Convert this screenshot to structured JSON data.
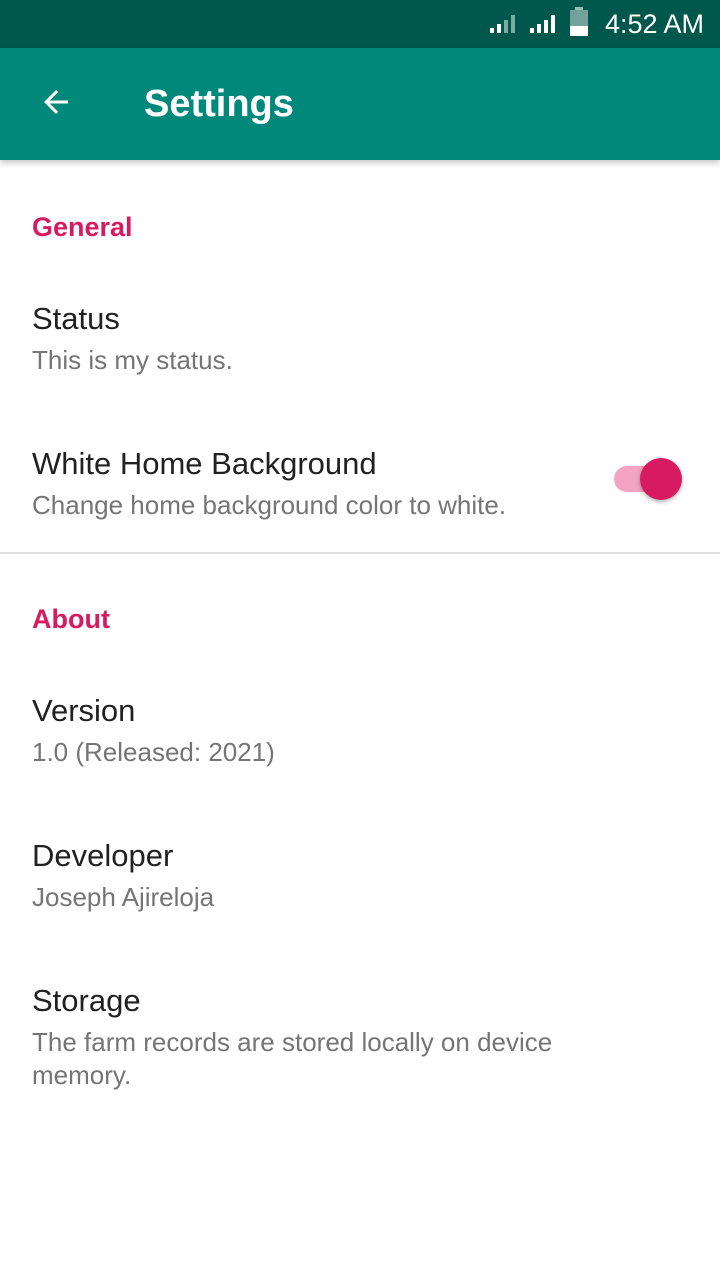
{
  "status_bar": {
    "time": "4:52 AM",
    "icons": [
      "signal-icon",
      "signal-icon",
      "battery-icon"
    ]
  },
  "app_bar": {
    "back_icon": "arrow-back-icon",
    "title": "Settings"
  },
  "colors": {
    "status_bar": "#00574b",
    "app_bar": "#00897b",
    "accent": "#d81b60"
  },
  "general": {
    "title": "General",
    "status": {
      "title": "Status",
      "summary": "This is my status."
    },
    "white_background": {
      "title": "White Home Background",
      "summary": "Change home background color to white.",
      "enabled": true
    }
  },
  "about": {
    "title": "About",
    "version": {
      "title": "Version",
      "summary": "1.0 (Released: 2021)"
    },
    "developer": {
      "title": "Developer",
      "summary": "Joseph Ajireloja"
    },
    "storage": {
      "title": "Storage",
      "summary": "The farm records are stored locally on device memory."
    }
  }
}
